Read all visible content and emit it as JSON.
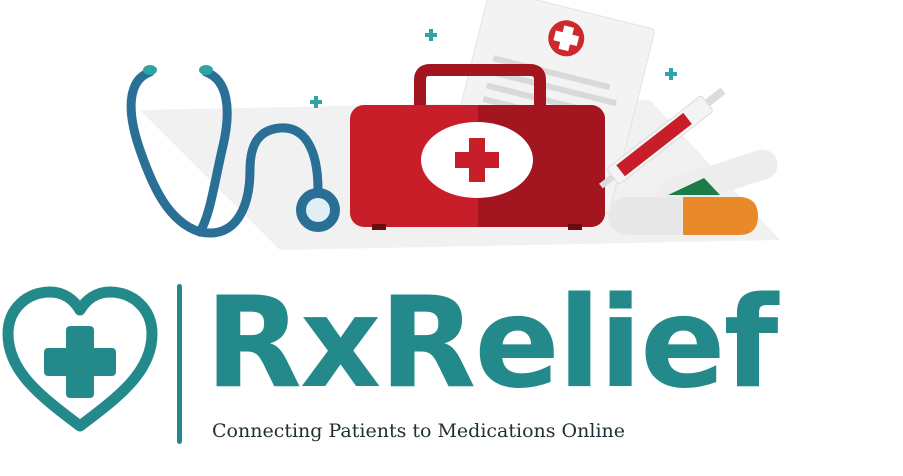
{
  "brand": {
    "name": "RxRelief",
    "tagline": "Connecting Patients to Medications Online"
  },
  "colors": {
    "brand_teal": "#23898a",
    "kit_red": "#c81e2a",
    "stethoscope_blue": "#2a6f96",
    "pill_orange": "#e8892a",
    "tagline_text": "#1f2f33"
  },
  "illustration": {
    "icons": [
      "stethoscope-icon",
      "first-aid-kit-icon",
      "medical-report-icon",
      "syringe-icon",
      "pill-capsule-icon",
      "sparkle-plus-icon"
    ]
  }
}
